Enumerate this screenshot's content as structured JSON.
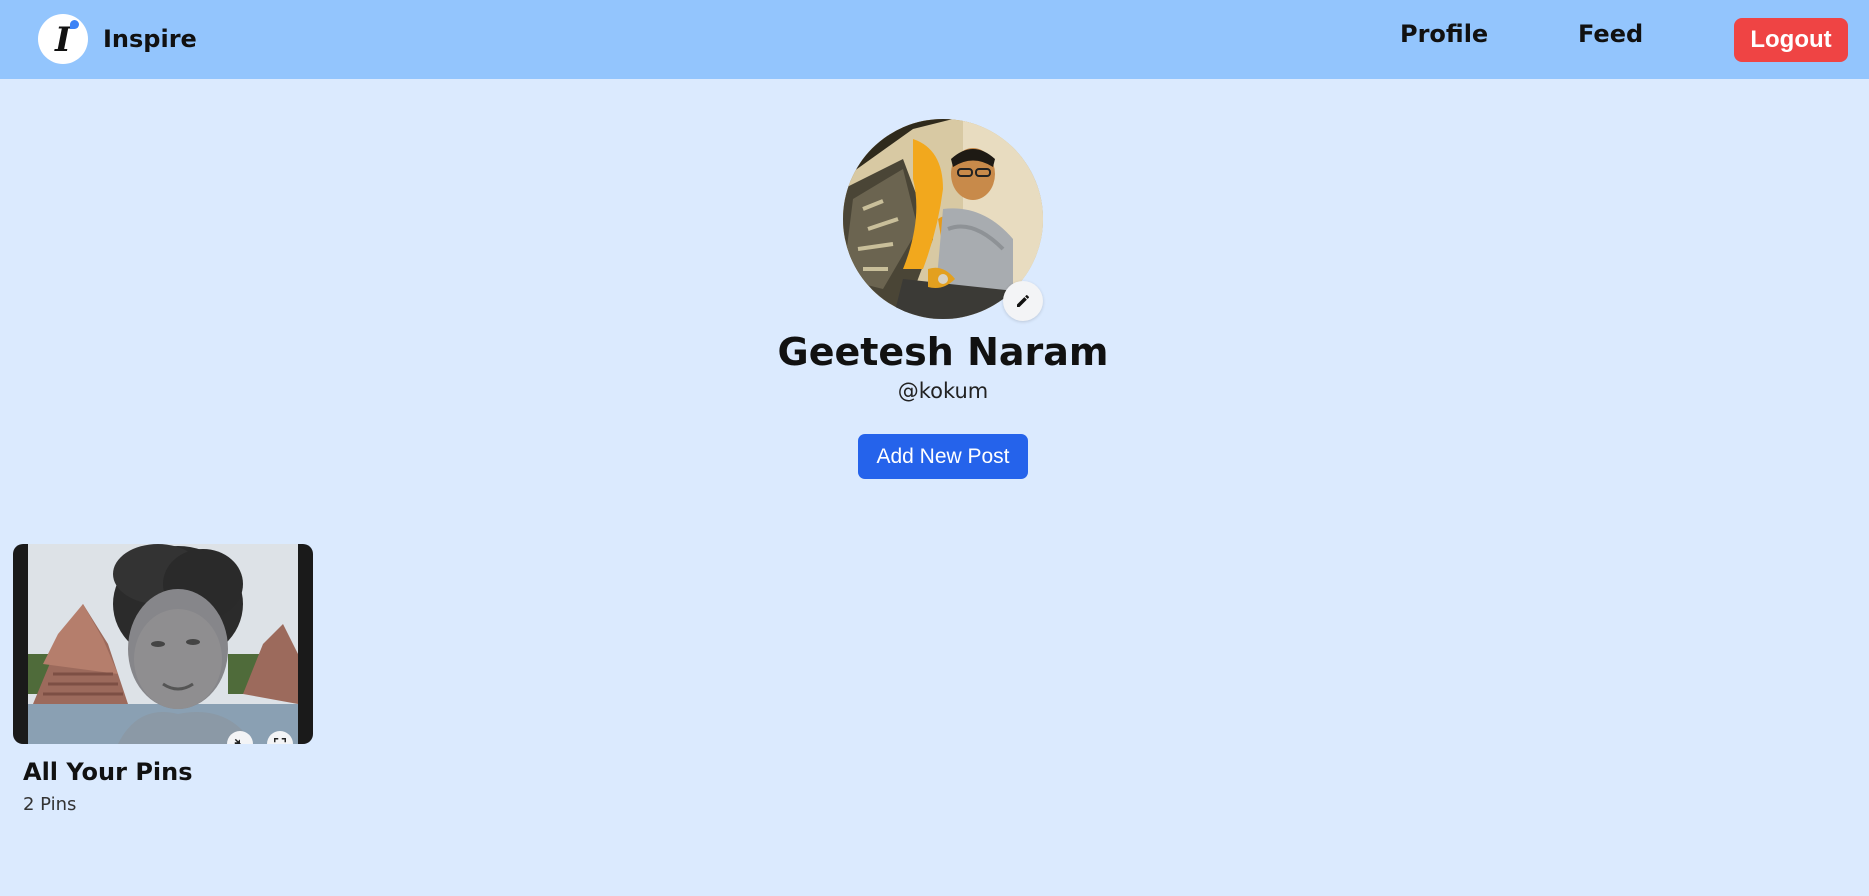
{
  "navbar": {
    "brand_name": "Inspire",
    "logo_letter": "I",
    "links": {
      "profile": "Profile",
      "feed": "Feed"
    },
    "logout_label": "Logout",
    "colors": {
      "background": "#93c5fd",
      "logout": "#ef4444"
    }
  },
  "profile": {
    "name": "Geetesh Naram",
    "handle": "@kokum",
    "avatar_icon": "user-photo",
    "edit_icon": "pencil-icon",
    "add_post_label": "Add New Post",
    "add_post_color": "#2563eb"
  },
  "boards": [
    {
      "title": "All Your Pins",
      "count": "2 Pins",
      "controls": [
        "mute-icon",
        "fullscreen-icon"
      ]
    }
  ],
  "page": {
    "background": "#dbeafe"
  }
}
